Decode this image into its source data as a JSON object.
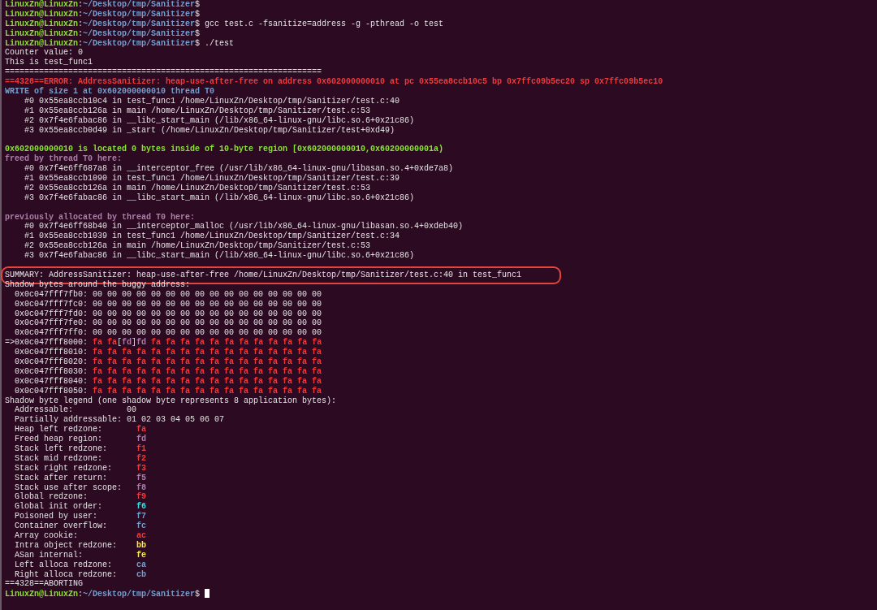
{
  "terminal": {
    "lines": [
      {
        "segments": [
          {
            "text": "LinuxZn@LinuxZn",
            "kind": "user"
          },
          {
            "text": ":"
          },
          {
            "text": "~/Desktop/tmp/Sanitizer",
            "kind": "path"
          },
          {
            "text": "$"
          }
        ]
      },
      {
        "segments": [
          {
            "text": "LinuxZn@LinuxZn",
            "kind": "user"
          },
          {
            "text": ":"
          },
          {
            "text": "~/Desktop/tmp/Sanitizer",
            "kind": "path"
          },
          {
            "text": "$"
          }
        ]
      },
      {
        "segments": [
          {
            "text": "LinuxZn@LinuxZn",
            "kind": "user"
          },
          {
            "text": ":"
          },
          {
            "text": "~/Desktop/tmp/Sanitizer",
            "kind": "path"
          },
          {
            "text": "$ gcc test.c -fsanitize=address -g -pthread -o test"
          }
        ]
      },
      {
        "segments": [
          {
            "text": "LinuxZn@LinuxZn",
            "kind": "user"
          },
          {
            "text": ":"
          },
          {
            "text": "~/Desktop/tmp/Sanitizer",
            "kind": "path"
          },
          {
            "text": "$"
          }
        ]
      },
      {
        "segments": [
          {
            "text": "LinuxZn@LinuxZn",
            "kind": "user"
          },
          {
            "text": ":"
          },
          {
            "text": "~/Desktop/tmp/Sanitizer",
            "kind": "path"
          },
          {
            "text": "$ ./test"
          }
        ]
      },
      {
        "segments": [
          {
            "text": "Counter value: 0"
          }
        ]
      },
      {
        "segments": [
          {
            "text": "This is test_func1"
          }
        ]
      },
      {
        "segments": [
          {
            "text": "================================================================="
          }
        ]
      },
      {
        "segments": [
          {
            "text": "==4328==ERROR: AddressSanitizer: heap-use-after-free on address 0x602000000010 at pc 0x55ea8ccb10c5 bp 0x7ffc09b5ec20 sp 0x7ffc09b5ec10",
            "kind": "error"
          }
        ]
      },
      {
        "segments": [
          {
            "text": "WRITE of size 1 at 0x602000000010 thread T0",
            "kind": "info"
          }
        ]
      },
      {
        "segments": [
          {
            "text": "    #0 0x55ea8ccb10c4 in test_func1 /home/LinuxZn/Desktop/tmp/Sanitizer/test.c:40"
          }
        ]
      },
      {
        "segments": [
          {
            "text": "    #1 0x55ea8ccb126a in main /home/LinuxZn/Desktop/tmp/Sanitizer/test.c:53"
          }
        ]
      },
      {
        "segments": [
          {
            "text": "    #2 0x7f4e6fabac86 in __libc_start_main (/lib/x86_64-linux-gnu/libc.so.6+0x21c86)"
          }
        ]
      },
      {
        "segments": [
          {
            "text": "    #3 0x55ea8ccb0d49 in _start (/home/LinuxZn/Desktop/tmp/Sanitizer/test+0xd49)"
          }
        ]
      },
      {
        "kind": "blank"
      },
      {
        "segments": [
          {
            "text": "0x602000000010 is located 0 bytes inside of 10-byte region [0x602000000010,0x60200000001a)",
            "kind": "located"
          }
        ]
      },
      {
        "segments": [
          {
            "text": "freed by thread T0 here:",
            "kind": "header"
          }
        ]
      },
      {
        "segments": [
          {
            "text": "    #0 0x7f4e6ff687a8 in __interceptor_free (/usr/lib/x86_64-linux-gnu/libasan.so.4+0xde7a8)"
          }
        ]
      },
      {
        "segments": [
          {
            "text": "    #1 0x55ea8ccb1090 in test_func1 /home/LinuxZn/Desktop/tmp/Sanitizer/test.c:39"
          }
        ]
      },
      {
        "segments": [
          {
            "text": "    #2 0x55ea8ccb126a in main /home/LinuxZn/Desktop/tmp/Sanitizer/test.c:53"
          }
        ]
      },
      {
        "segments": [
          {
            "text": "    #3 0x7f4e6fabac86 in __libc_start_main (/lib/x86_64-linux-gnu/libc.so.6+0x21c86)"
          }
        ]
      },
      {
        "kind": "blank"
      },
      {
        "segments": [
          {
            "text": "previously allocated by thread T0 here:",
            "kind": "header"
          }
        ]
      },
      {
        "segments": [
          {
            "text": "    #0 0x7f4e6ff68b40 in __interceptor_malloc (/usr/lib/x86_64-linux-gnu/libasan.so.4+0xdeb40)"
          }
        ]
      },
      {
        "segments": [
          {
            "text": "    #1 0x55ea8ccb1039 in test_func1 /home/LinuxZn/Desktop/tmp/Sanitizer/test.c:34"
          }
        ]
      },
      {
        "segments": [
          {
            "text": "    #2 0x55ea8ccb126a in main /home/LinuxZn/Desktop/tmp/Sanitizer/test.c:53"
          }
        ]
      },
      {
        "segments": [
          {
            "text": "    #3 0x7f4e6fabac86 in __libc_start_main (/lib/x86_64-linux-gnu/libc.so.6+0x21c86)"
          }
        ]
      },
      {
        "kind": "blank"
      },
      {
        "highlighted": true,
        "segments": [
          {
            "text": "SUMMARY: AddressSanitizer: heap-use-after-free /home/LinuxZn/Desktop/tmp/Sanitizer/test.c:40 in test_func1"
          }
        ]
      },
      {
        "segments": [
          {
            "text": "Shadow bytes around the buggy address:"
          }
        ]
      },
      {
        "segments": [
          {
            "text": "  0x0c047fff7fb0: 00 00 00 00 00 00 00 00 00 00 00 00 00 00 00 00"
          }
        ]
      },
      {
        "segments": [
          {
            "text": "  0x0c047fff7fc0: 00 00 00 00 00 00 00 00 00 00 00 00 00 00 00 00"
          }
        ]
      },
      {
        "segments": [
          {
            "text": "  0x0c047fff7fd0: 00 00 00 00 00 00 00 00 00 00 00 00 00 00 00 00"
          }
        ]
      },
      {
        "segments": [
          {
            "text": "  0x0c047fff7fe0: 00 00 00 00 00 00 00 00 00 00 00 00 00 00 00 00"
          }
        ]
      },
      {
        "segments": [
          {
            "text": "  0x0c047fff7ff0: 00 00 00 00 00 00 00 00 00 00 00 00 00 00 00 00"
          }
        ]
      },
      {
        "segments": [
          {
            "text": "=>0x0c047fff8000: "
          },
          {
            "text": "fa fa",
            "kind": "red"
          },
          {
            "text": "["
          },
          {
            "text": "fd",
            "kind": "purple"
          },
          {
            "text": "]"
          },
          {
            "text": "fd",
            "kind": "purple"
          },
          {
            "text": " fa fa fa fa fa fa fa fa fa fa fa fa",
            "kind": "red"
          }
        ]
      },
      {
        "segments": [
          {
            "text": "  0x0c047fff8010: "
          },
          {
            "text": "fa fa fa fa fa fa fa fa fa fa fa fa fa fa fa fa",
            "kind": "red"
          }
        ]
      },
      {
        "segments": [
          {
            "text": "  0x0c047fff8020: "
          },
          {
            "text": "fa fa fa fa fa fa fa fa fa fa fa fa fa fa fa fa",
            "kind": "red"
          }
        ]
      },
      {
        "segments": [
          {
            "text": "  0x0c047fff8030: "
          },
          {
            "text": "fa fa fa fa fa fa fa fa fa fa fa fa fa fa fa fa",
            "kind": "red"
          }
        ]
      },
      {
        "segments": [
          {
            "text": "  0x0c047fff8040: "
          },
          {
            "text": "fa fa fa fa fa fa fa fa fa fa fa fa fa fa fa fa",
            "kind": "red"
          }
        ]
      },
      {
        "segments": [
          {
            "text": "  0x0c047fff8050: "
          },
          {
            "text": "fa fa fa fa fa fa fa fa fa fa fa fa fa fa fa fa",
            "kind": "red"
          }
        ]
      },
      {
        "segments": [
          {
            "text": "Shadow byte legend (one shadow byte represents 8 application bytes):"
          }
        ]
      },
      {
        "segments": [
          {
            "text": "  Addressable:           00"
          }
        ]
      },
      {
        "segments": [
          {
            "text": "  Partially addressable: 01 02 03 04 05 06 07"
          }
        ]
      },
      {
        "segments": [
          {
            "text": "  Heap left redzone:       "
          },
          {
            "text": "fa",
            "kind": "red"
          }
        ]
      },
      {
        "segments": [
          {
            "text": "  Freed heap region:       "
          },
          {
            "text": "fd",
            "kind": "purple"
          }
        ]
      },
      {
        "segments": [
          {
            "text": "  Stack left redzone:      "
          },
          {
            "text": "f1",
            "kind": "red"
          }
        ]
      },
      {
        "segments": [
          {
            "text": "  Stack mid redzone:       "
          },
          {
            "text": "f2",
            "kind": "red"
          }
        ]
      },
      {
        "segments": [
          {
            "text": "  Stack right redzone:     "
          },
          {
            "text": "f3",
            "kind": "red"
          }
        ]
      },
      {
        "segments": [
          {
            "text": "  Stack after return:      "
          },
          {
            "text": "f5",
            "kind": "purple"
          }
        ]
      },
      {
        "segments": [
          {
            "text": "  Stack use after scope:   "
          },
          {
            "text": "f8",
            "kind": "purple"
          }
        ]
      },
      {
        "segments": [
          {
            "text": "  Global redzone:          "
          },
          {
            "text": "f9",
            "kind": "red"
          }
        ]
      },
      {
        "segments": [
          {
            "text": "  Global init order:       "
          },
          {
            "text": "f6",
            "kind": "cyan"
          }
        ]
      },
      {
        "segments": [
          {
            "text": "  Poisoned by user:        "
          },
          {
            "text": "f7",
            "kind": "blue"
          }
        ]
      },
      {
        "segments": [
          {
            "text": "  Container overflow:      "
          },
          {
            "text": "fc",
            "kind": "blue"
          }
        ]
      },
      {
        "segments": [
          {
            "text": "  Array cookie:            "
          },
          {
            "text": "ac",
            "kind": "red"
          }
        ]
      },
      {
        "segments": [
          {
            "text": "  Intra object redzone:    "
          },
          {
            "text": "bb",
            "kind": "yellow"
          }
        ]
      },
      {
        "segments": [
          {
            "text": "  ASan internal:           "
          },
          {
            "text": "fe",
            "kind": "yellow"
          }
        ]
      },
      {
        "segments": [
          {
            "text": "  Left alloca redzone:     "
          },
          {
            "text": "ca",
            "kind": "blue"
          }
        ]
      },
      {
        "segments": [
          {
            "text": "  Right alloca redzone:    "
          },
          {
            "text": "cb",
            "kind": "blue"
          }
        ]
      },
      {
        "segments": [
          {
            "text": "==4328==ABORTING"
          }
        ]
      },
      {
        "cursor": true,
        "segments": [
          {
            "text": "LinuxZn@LinuxZn",
            "kind": "user"
          },
          {
            "text": ":"
          },
          {
            "text": "~/Desktop/tmp/Sanitizer",
            "kind": "path"
          },
          {
            "text": "$ "
          }
        ]
      }
    ]
  }
}
